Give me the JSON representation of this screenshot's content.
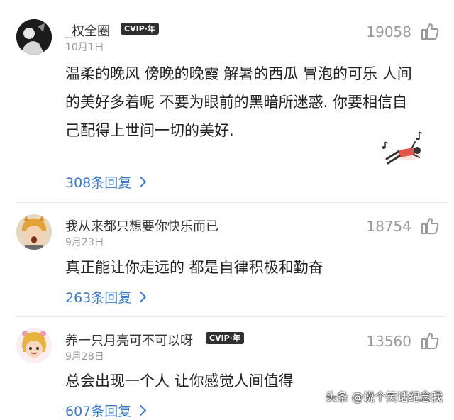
{
  "comments": [
    {
      "username": "_权全圈",
      "vip_badge": "CVIP·年",
      "date": "10月1日",
      "likes": "19058",
      "text_lines": [
        "温柔的晚风 傍晚的晚霞 解暑的西瓜 冒泡的可乐 人间",
        "的美好多着呢 不要为眼前的黑暗所迷惑. 你要相信自",
        "己配得上世间一切的美好."
      ],
      "replies": "308条回复"
    },
    {
      "username": "我从来都只想要你快乐而已",
      "date": "9月23日",
      "likes": "18754",
      "text_lines": [
        "真正能让你走远的 都是自律积极和勤奋"
      ],
      "replies": "263条回复"
    },
    {
      "username": "养一只月亮可不可以呀",
      "vip_badge": "CVIP·年",
      "date": "9月28日",
      "likes": "13560",
      "text_lines": [
        "总会出现一个人 让你感觉人间值得"
      ],
      "replies": "607条回复"
    }
  ],
  "watermark": "头条 @说个笑话纪念我",
  "colors": {
    "link": "#3a79c5",
    "meta": "#9a9a9a",
    "text": "#222222"
  },
  "icons": [
    "thumbs-up-icon",
    "chevron-right-icon",
    "music-note-icon"
  ]
}
